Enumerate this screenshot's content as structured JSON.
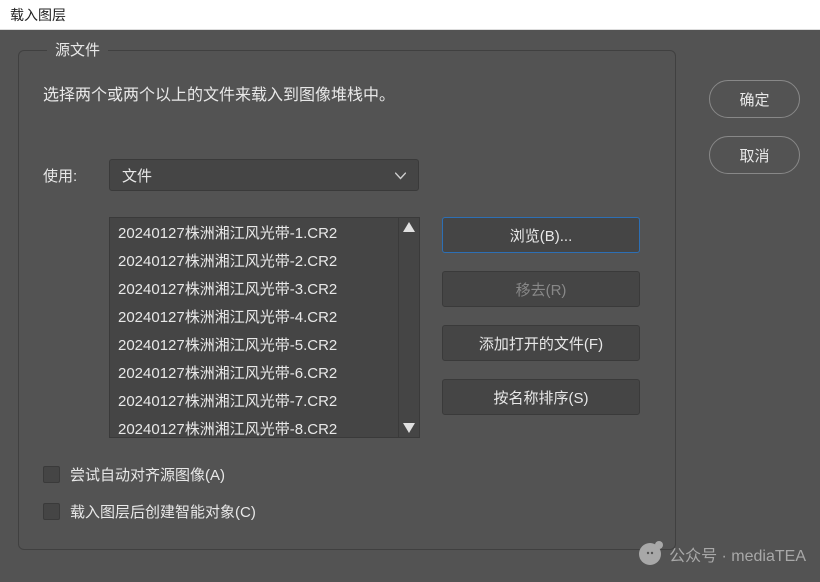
{
  "window": {
    "title": "载入图层"
  },
  "fieldset": {
    "legend": "源文件",
    "instruction": "选择两个或两个以上的文件来载入到图像堆栈中。"
  },
  "use": {
    "label": "使用:",
    "selected": "文件"
  },
  "files": [
    "20240127株洲湘江风光带-1.CR2",
    "20240127株洲湘江风光带-2.CR2",
    "20240127株洲湘江风光带-3.CR2",
    "20240127株洲湘江风光带-4.CR2",
    "20240127株洲湘江风光带-5.CR2",
    "20240127株洲湘江风光带-6.CR2",
    "20240127株洲湘江风光带-7.CR2",
    "20240127株洲湘江风光带-8.CR2"
  ],
  "actions": {
    "browse": "浏览(B)...",
    "remove": "移去(R)",
    "addOpen": "添加打开的文件(F)",
    "sortName": "按名称排序(S)"
  },
  "checkboxes": {
    "autoAlign": "尝试自动对齐源图像(A)",
    "smartObj": "载入图层后创建智能对象(C)"
  },
  "side": {
    "ok": "确定",
    "cancel": "取消"
  },
  "watermark": "公众号 · mediaTEA"
}
